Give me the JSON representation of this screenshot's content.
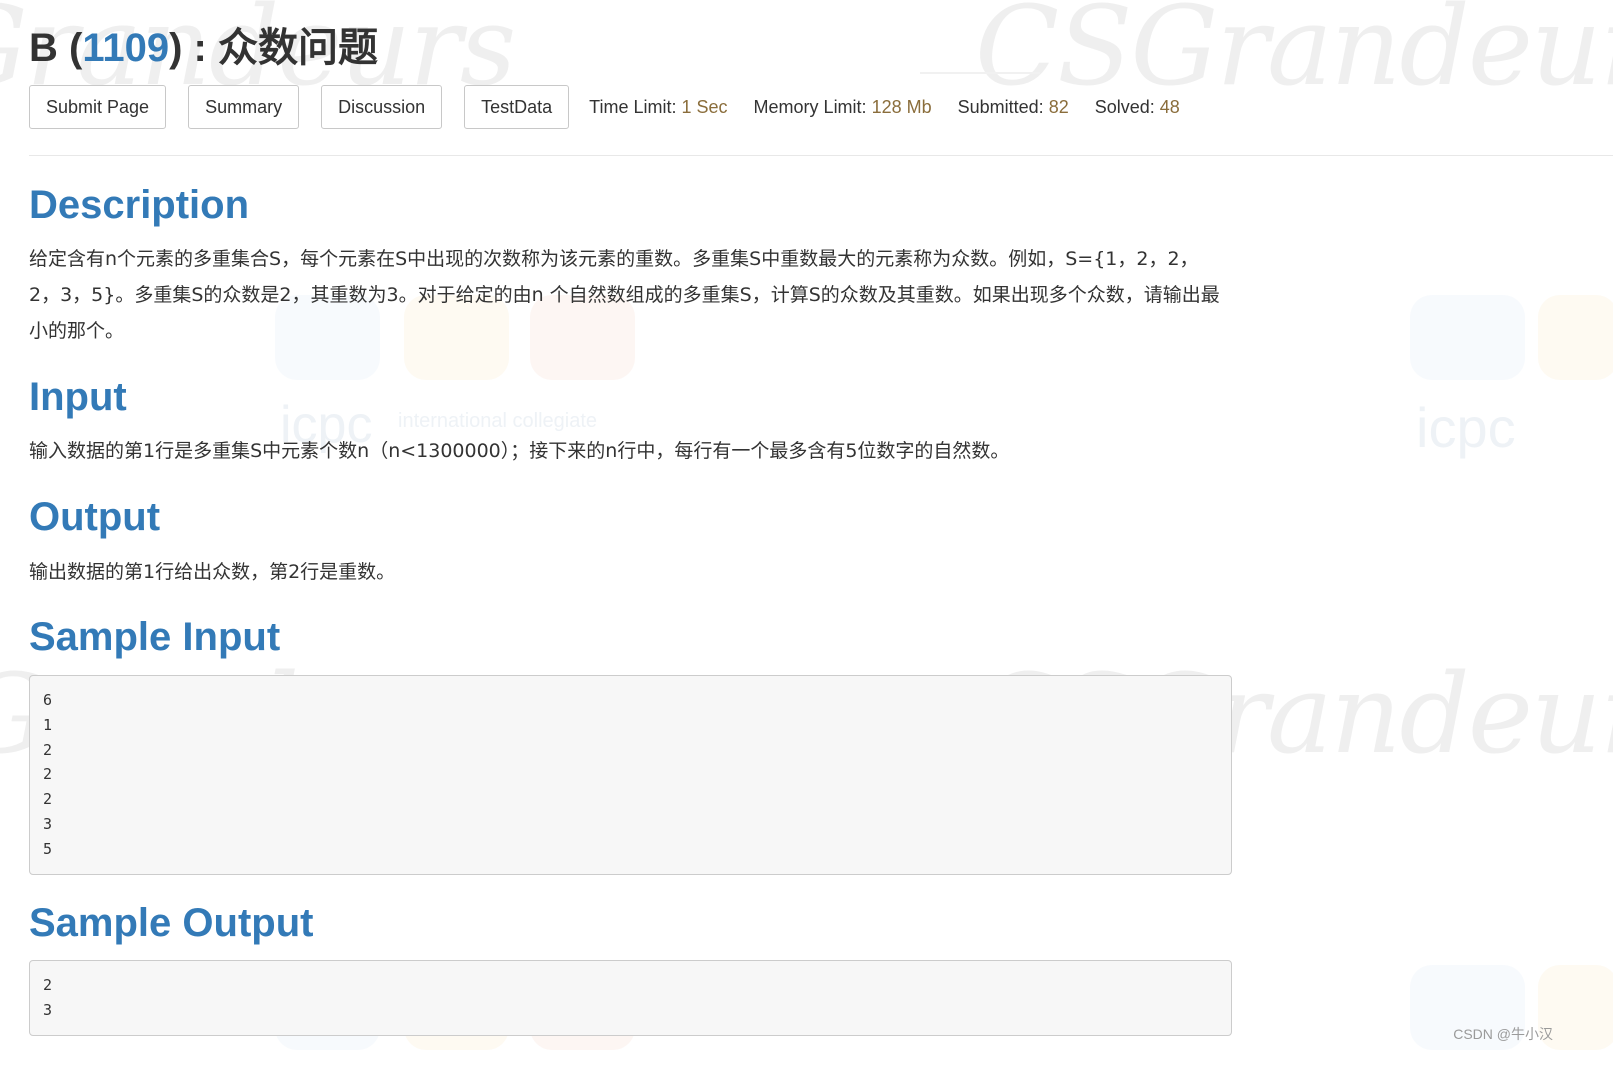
{
  "problem": {
    "letter": "B",
    "id": "1109",
    "name": "众数问题"
  },
  "toolbar": {
    "submit_label": "Submit Page",
    "summary_label": "Summary",
    "discussion_label": "Discussion",
    "testdata_label": "TestData"
  },
  "limits": {
    "time_label": "Time Limit:",
    "time_value": "1 Sec",
    "memory_label": "Memory Limit:",
    "memory_value": "128 Mb",
    "submitted_label": "Submitted:",
    "submitted_value": "82",
    "solved_label": "Solved:",
    "solved_value": "48"
  },
  "sections": {
    "description": {
      "heading": "Description",
      "text": "给定含有n个元素的多重集合S，每个元素在S中出现的次数称为该元素的重数。多重集S中重数最大的元素称为众数。例如，S={1，2，2，2，3，5}。多重集S的众数是2，其重数为3。对于给定的由n 个自然数组成的多重集S，计算S的众数及其重数。如果出现多个众数，请输出最小的那个。"
    },
    "input": {
      "heading": "Input",
      "text": "输入数据的第1行是多重集S中元素个数n（n<1300000）；接下来的n行中，每行有一个最多含有5位数字的自然数。"
    },
    "output": {
      "heading": "Output",
      "text": "输出数据的第1行给出众数，第2行是重数。"
    },
    "sample_input": {
      "heading": "Sample Input",
      "content": "6\n1\n2\n2\n2\n3\n5"
    },
    "sample_output": {
      "heading": "Sample Output",
      "content": "2\n3"
    }
  },
  "watermarks": {
    "brand_script": "CSGrandeurs",
    "brand_partial": "Grandeurs",
    "icpc": "icpc",
    "icpc_caption": "international collegiate"
  },
  "credit": "CSDN @牛小汉"
}
